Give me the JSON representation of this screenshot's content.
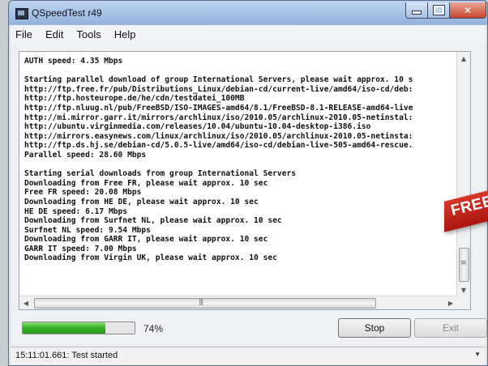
{
  "window": {
    "title": "QSpeedTest r49"
  },
  "menu": [
    "File",
    "Edit",
    "Tools",
    "Help"
  ],
  "log": {
    "lines": [
      "AUTH speed: 4.35 Mbps",
      "",
      "Starting parallel download of group International Servers, please wait approx. 10 s",
      "http://ftp.free.fr/pub/Distributions_Linux/debian-cd/current-live/amd64/iso-cd/deb:",
      "http://ftp.hosteurope.de/he/cdn/testdatei_100MB",
      "http://ftp.nluug.nl/pub/FreeBSD/ISO-IMAGES-amd64/8.1/FreeBSD-8.1-RELEASE-amd64-live",
      "http://mi.mirror.garr.it/mirrors/archlinux/iso/2010.05/archlinux-2010.05-netinstal:",
      "http://ubuntu.virginmedia.com/releases/10.04/ubuntu-10.04-desktop-i386.iso",
      "http://mirrors.easynews.com/linux/archlinux/iso/2010.05/archlinux-2010.05-netinsta:",
      "http://ftp.ds.hj.se/debian-cd/5.0.5-live/amd64/iso-cd/debian-live-505-amd64-rescue.",
      "Parallel speed: 28.60 Mbps",
      "",
      "Starting serial downloads from group International Servers",
      "Downloading from Free FR, please wait approx. 10 sec",
      "Free FR speed: 20.08 Mbps",
      "Downloading from HE DE, please wait approx. 10 sec",
      "HE DE speed: 6.17 Mbps",
      "Downloading from Surfnet NL, please wait approx. 10 sec",
      "Surfnet NL speed: 9.54 Mbps",
      "Downloading from GARR IT, please wait approx. 10 sec",
      "GARR IT speed: 7.00 Mbps",
      "Downloading from Virgin UK, please wait approx. 10 sec"
    ],
    "hscroll_grip": "III"
  },
  "progress": {
    "value": 74,
    "label": "74%",
    "color": "#35b026"
  },
  "buttons": {
    "stop": "Stop",
    "exit": "Exit"
  },
  "status": {
    "text": "15:11:01.661: Test started"
  },
  "overlay": {
    "text": "FREE",
    "color": "#c8251a"
  },
  "icons": {
    "app": "app-window-icon",
    "minimize": "minimize-icon",
    "maximize": "maximize-icon",
    "close": "close-icon"
  }
}
